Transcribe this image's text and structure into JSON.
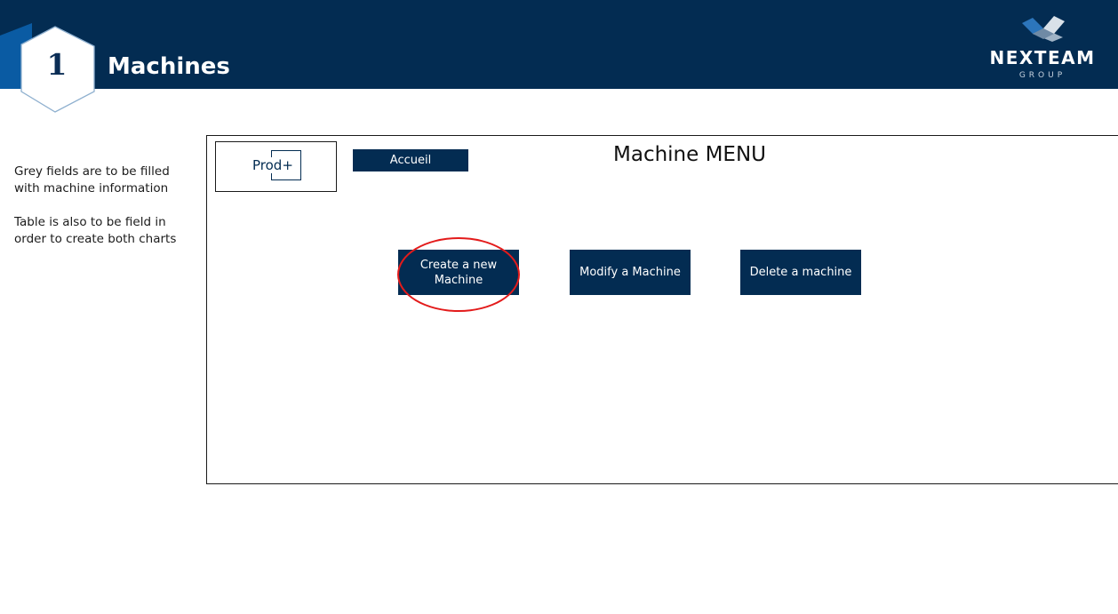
{
  "slide": {
    "number": "1",
    "title": "Machines"
  },
  "logo": {
    "name": "NEXTEAM",
    "subtitle": "GROUP"
  },
  "notes": [
    "Grey fields are to be filled with machine information",
    "Table is also to be field in order to create both charts"
  ],
  "app": {
    "logo_text": "Prod+",
    "home_button": "Accueil",
    "menu_title": "Machine MENU",
    "buttons": {
      "create": "Create a new Machine",
      "modify": "Modify a Machine",
      "delete": "Delete a machine"
    }
  },
  "colors": {
    "navy": "#032c52",
    "highlight": "#e31b1b"
  }
}
